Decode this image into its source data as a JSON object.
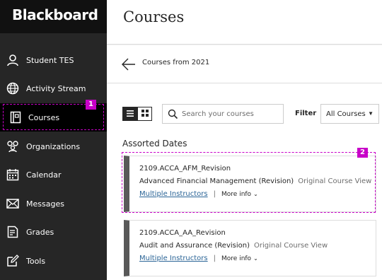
{
  "app": {
    "logo": "Blackboard"
  },
  "sidebar": {
    "items": [
      {
        "label": "Student TES",
        "icon": "user-icon"
      },
      {
        "label": "Activity Stream",
        "icon": "globe-icon"
      },
      {
        "label": "Courses",
        "icon": "courses-icon",
        "active": true
      },
      {
        "label": "Organizations",
        "icon": "organizations-icon"
      },
      {
        "label": "Calendar",
        "icon": "calendar-icon"
      },
      {
        "label": "Messages",
        "icon": "envelope-icon"
      },
      {
        "label": "Grades",
        "icon": "grades-icon"
      },
      {
        "label": "Tools",
        "icon": "tools-icon"
      }
    ]
  },
  "header": {
    "title": "Courses"
  },
  "breadcrumb": {
    "text": "Courses from 2021"
  },
  "toolbar": {
    "search_placeholder": "Search your courses",
    "filter_label": "Filter",
    "filter_value": "All Courses"
  },
  "section": {
    "title": "Assorted Dates"
  },
  "courses": [
    {
      "code": "2109.ACCA_AFM_Revision",
      "name": "Advanced Financial Management (Revision)",
      "type": "Original Course View",
      "instructors": "Multiple Instructors",
      "more": "More info"
    },
    {
      "code": "2109.ACCA_AA_Revision",
      "name": "Audit and Assurance (Revision)",
      "type": "Original Course View",
      "instructors": "Multiple Instructors",
      "more": "More info"
    }
  ],
  "annotations": {
    "badge_1": "1",
    "badge_2": "2"
  },
  "colors": {
    "sidebar_bg": "#262626",
    "logo_bg": "#111111",
    "annotation": "#c800c8",
    "link": "#2a6496"
  }
}
